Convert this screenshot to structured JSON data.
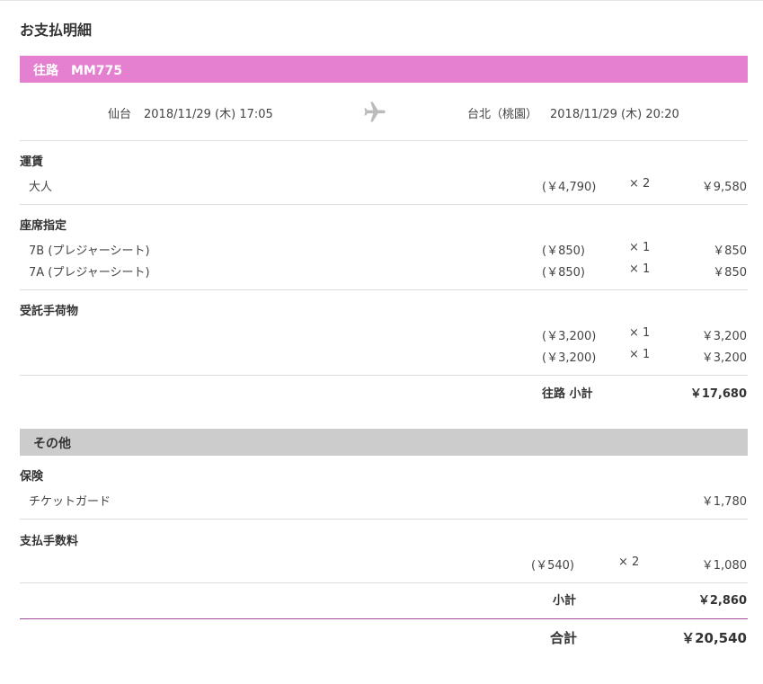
{
  "page": {
    "title": "お支払明細"
  },
  "outbound": {
    "header": "往路　MM775",
    "from_city": "仙台",
    "from_datetime": "2018/11/29 (木) 17:05",
    "to_city": "台北（桃園）",
    "to_datetime": "2018/11/29 (木) 20:20",
    "icon": "airplane-icon",
    "sections": [
      {
        "title": "運賃",
        "rows": [
          {
            "label": "大人",
            "unit": "(￥4,790)",
            "qty": "× 2",
            "amount": "￥9,580"
          }
        ]
      },
      {
        "title": "座席指定",
        "rows": [
          {
            "label": "7B (プレジャーシート)",
            "unit": "(￥850)",
            "qty": "× 1",
            "amount": "￥850"
          },
          {
            "label": "7A (プレジャーシート)",
            "unit": "(￥850)",
            "qty": "× 1",
            "amount": "￥850"
          }
        ]
      },
      {
        "title": "受託手荷物",
        "rows": [
          {
            "label": "",
            "unit": "(￥3,200)",
            "qty": "× 1",
            "amount": "￥3,200"
          },
          {
            "label": "",
            "unit": "(￥3,200)",
            "qty": "× 1",
            "amount": "￥3,200"
          }
        ]
      }
    ],
    "subtotal_label": "往路 小計",
    "subtotal_amount": "￥17,680"
  },
  "other": {
    "header": "その他",
    "sections": [
      {
        "title": "保険",
        "rows": [
          {
            "label": "チケットガード",
            "unit": "",
            "qty": "",
            "amount": "￥1,780"
          }
        ]
      },
      {
        "title": "支払手数料",
        "rows": [
          {
            "label": "",
            "unit": "(￥540)",
            "qty": "× 2",
            "amount": "￥1,080"
          }
        ]
      }
    ],
    "subtotal_label": "小計",
    "subtotal_amount": "￥2,860"
  },
  "total": {
    "label": "合計",
    "amount": "￥20,540"
  },
  "colors": {
    "accent_band": "#e57fcf",
    "other_band": "#cccccc",
    "total_rule": "#a04a9e",
    "icon": "#bbbbbb"
  }
}
